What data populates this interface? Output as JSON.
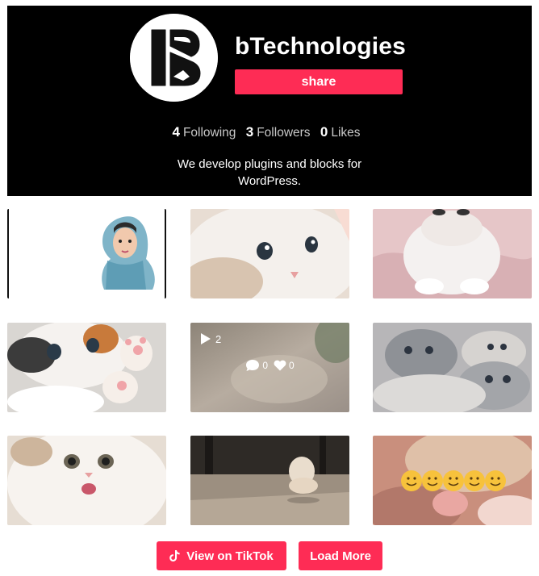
{
  "profile": {
    "name": "bTechnologies",
    "share_label": "share",
    "stats": {
      "following_count": "4",
      "following_label": "Following",
      "followers_count": "3",
      "followers_label": "Followers",
      "likes_count": "0",
      "likes_label": "Likes"
    },
    "bio": "We develop plugins and blocks for WordPress."
  },
  "videos": [
    {
      "thumb": "hijab-illustration-icon"
    },
    {
      "thumb": "white-kitten-closeup"
    },
    {
      "thumb": "white-kitten-on-pink-blanket"
    },
    {
      "thumb": "calico-kitten-paws"
    },
    {
      "thumb": "blurred-video",
      "plays": "2",
      "comments": "0",
      "likes": "0"
    },
    {
      "thumb": "grey-kittens-group"
    },
    {
      "thumb": "fluffy-white-kitten-surprised"
    },
    {
      "thumb": "kitten-on-floor"
    },
    {
      "thumb": "smiley-emojis-on-paw"
    }
  ],
  "actions": {
    "view_label": "View on TikTok",
    "load_label": "Load More"
  },
  "colors": {
    "accent": "#fe2c55",
    "header_bg": "#000000"
  }
}
